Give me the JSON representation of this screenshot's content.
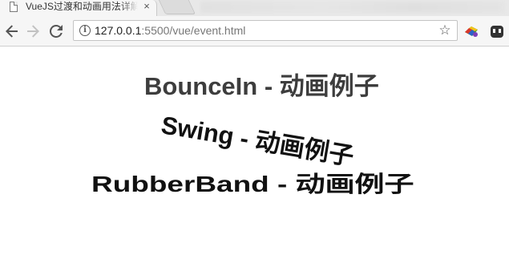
{
  "browser": {
    "tab": {
      "title": "VueJS过渡和动画用法详解",
      "close_glyph": "×",
      "favicon": "page-icon"
    },
    "toolbar": {
      "back_icon": "arrow-left-icon",
      "forward_icon": "arrow-right-icon",
      "reload_icon": "reload-icon",
      "url_host": "127.0.0.1",
      "url_rest": ":5500/vue/event.html",
      "info_glyph": "i",
      "bookmark_glyph": "☆"
    },
    "extensions": [
      "colorful-extension-icon",
      "ghost-extension-icon"
    ]
  },
  "page": {
    "examples": [
      {
        "animation": "BounceIn",
        "text": "BounceIn - 动画例子"
      },
      {
        "animation": "Swing",
        "text": "Swing - 动画例子"
      },
      {
        "animation": "RubberBand",
        "text": "RubberBand - 动画例子"
      }
    ]
  }
}
